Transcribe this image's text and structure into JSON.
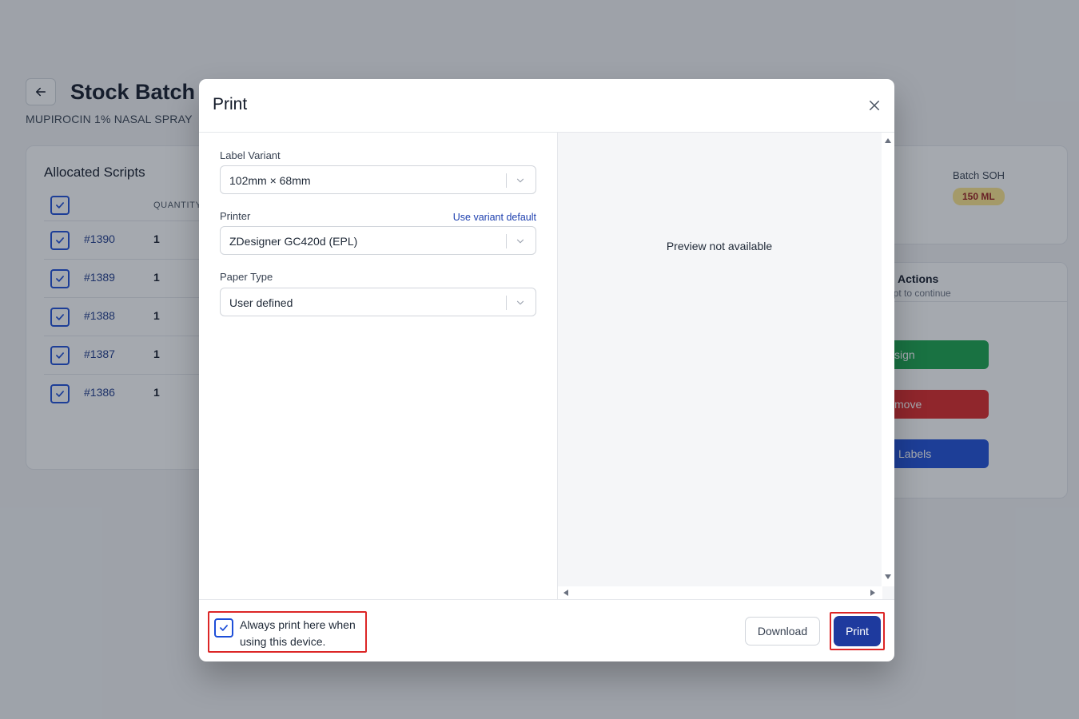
{
  "page": {
    "title": "Stock Batch",
    "subtitle": "MUPIROCIN 1% NASAL SPRAY"
  },
  "scripts_card": {
    "title": "Allocated Scripts",
    "column_quantity": "QUANTITY",
    "rows": [
      {
        "id": "#1390",
        "qty": "1"
      },
      {
        "id": "#1389",
        "qty": "1"
      },
      {
        "id": "#1388",
        "qty": "1"
      },
      {
        "id": "#1387",
        "qty": "1"
      },
      {
        "id": "#1386",
        "qty": "1"
      }
    ]
  },
  "soh_card": {
    "label": "Batch SOH",
    "value": "150 ML"
  },
  "actions_card": {
    "title": "Actions",
    "subtitle": "ipt to continue",
    "assign_label": "sign",
    "remove_label": "move",
    "labels_label": "Labels"
  },
  "modal": {
    "title": "Print",
    "label_variant": {
      "label": "Label Variant",
      "value": "102mm × 68mm"
    },
    "printer": {
      "label": "Printer",
      "value": "ZDesigner GC420d (EPL)",
      "link": "Use variant default"
    },
    "paper_type": {
      "label": "Paper Type",
      "value": "User defined"
    },
    "preview_text": "Preview not available",
    "always_print": {
      "checked": true,
      "line1": "Always print here when",
      "line2": "using this device."
    },
    "download_label": "Download",
    "print_label": "Print"
  },
  "colors": {
    "accent": "#1e3a9e",
    "highlight": "#dc2626",
    "overlay": "rgba(31,41,55,0.4)"
  }
}
